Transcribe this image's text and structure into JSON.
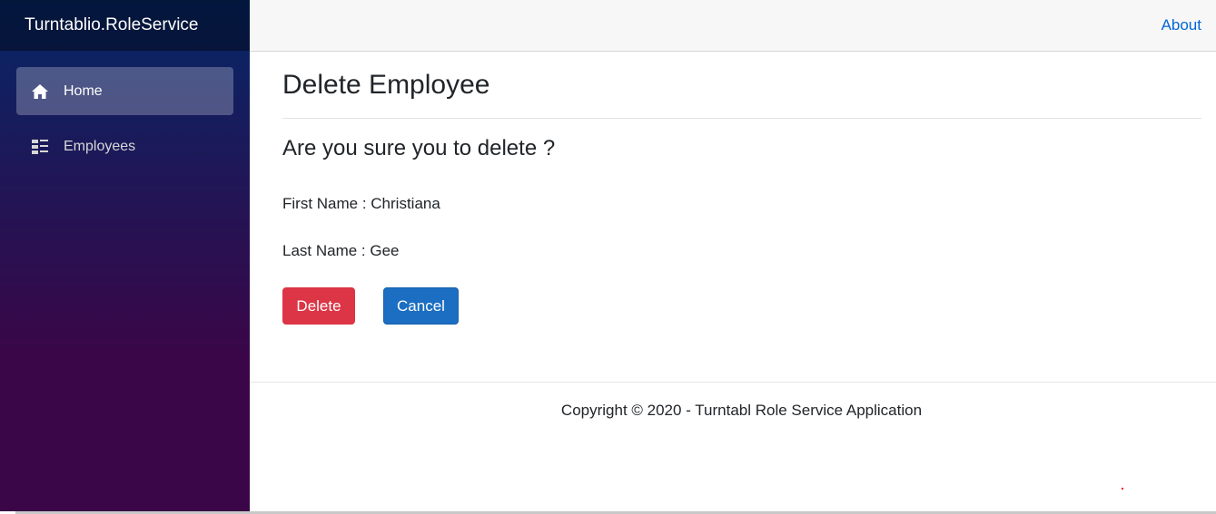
{
  "sidebar": {
    "brand": "Turntablio.RoleService",
    "items": [
      {
        "label": "Home",
        "icon": "home-icon",
        "active": true
      },
      {
        "label": "Employees",
        "icon": "list-icon",
        "active": false
      }
    ]
  },
  "topbar": {
    "about_label": "About"
  },
  "main": {
    "title": "Delete Employee",
    "question": "Are you sure you to delete ?",
    "first_name": "First Name : Christiana",
    "last_name": "Last Name : Gee",
    "delete_label": "Delete",
    "cancel_label": "Cancel"
  },
  "footer": {
    "text": "Copyright © 2020 - Turntabl Role Service Application"
  },
  "colors": {
    "delete": "#dc3545",
    "cancel": "#1b6ec2",
    "link": "#0366d6",
    "sidebar_top": "#052767",
    "sidebar_bottom": "#3a0647"
  }
}
